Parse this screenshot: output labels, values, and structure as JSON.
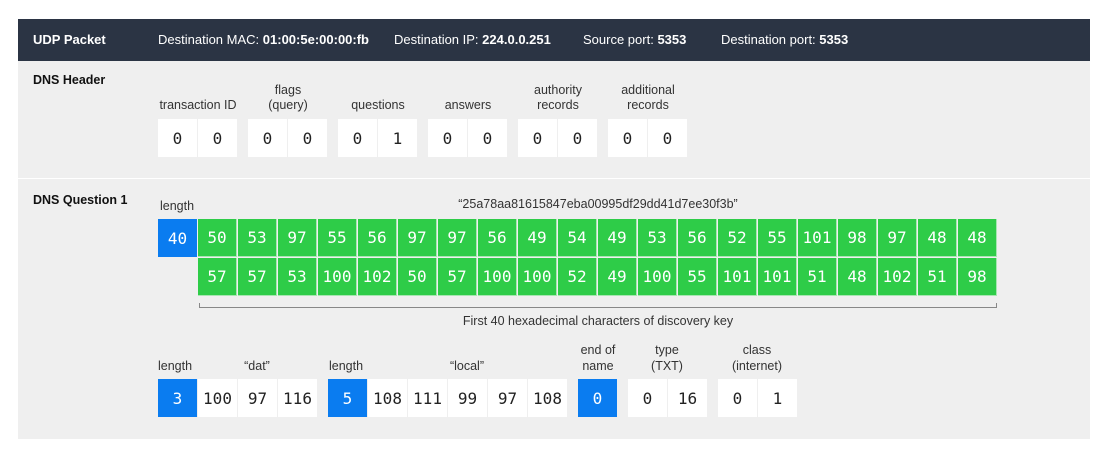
{
  "topbar": {
    "title": "UDP Packet",
    "dest_mac_label": "Destination MAC:",
    "dest_mac_value": "01:00:5e:00:00:fb",
    "dest_ip_label": "Destination IP:",
    "dest_ip_value": "224.0.0.251",
    "src_port_label": "Source port:",
    "src_port_value": "5353",
    "dest_port_label": "Destination port:",
    "dest_port_value": "5353"
  },
  "header": {
    "title": "DNS Header",
    "fields": [
      {
        "label1": "",
        "label2": "transaction ID",
        "values": [
          "0",
          "0"
        ]
      },
      {
        "label1": "flags",
        "label2": "(query)",
        "values": [
          "0",
          "0"
        ]
      },
      {
        "label1": "",
        "label2": "questions",
        "values": [
          "0",
          "1"
        ]
      },
      {
        "label1": "",
        "label2": "answers",
        "values": [
          "0",
          "0"
        ]
      },
      {
        "label1": "authority",
        "label2": "records",
        "values": [
          "0",
          "0"
        ]
      },
      {
        "label1": "additional",
        "label2": "records",
        "values": [
          "0",
          "0"
        ]
      }
    ]
  },
  "question": {
    "title": "DNS Question 1",
    "length_label": "length",
    "length_value": "40",
    "key_string": "“25a78aa81615847eba00995df29dd41d7ee30f3b”",
    "row1": [
      "50",
      "53",
      "97",
      "55",
      "56",
      "97",
      "97",
      "56",
      "49",
      "54",
      "49",
      "53",
      "56",
      "52",
      "55",
      "101",
      "98",
      "97",
      "48",
      "48"
    ],
    "row2": [
      "57",
      "57",
      "53",
      "100",
      "102",
      "50",
      "57",
      "100",
      "100",
      "52",
      "49",
      "100",
      "55",
      "101",
      "101",
      "51",
      "48",
      "102",
      "51",
      "98"
    ],
    "bracket_caption": "First 40 hexadecimal characters of discovery key",
    "dat_length_label": "length",
    "dat_length": "3",
    "dat_label": "“dat”",
    "dat_values": [
      "100",
      "97",
      "116"
    ],
    "local_length_label": "length",
    "local_length": "5",
    "local_label": "“local”",
    "local_values": [
      "108",
      "111",
      "99",
      "97",
      "108"
    ],
    "end_label1": "end of",
    "end_label2": "name",
    "end_value": "0",
    "type_label1": "type",
    "type_label2": "(TXT)",
    "type_values": [
      "0",
      "16"
    ],
    "class_label1": "class",
    "class_label2": "(internet)",
    "class_values": [
      "0",
      "1"
    ]
  },
  "colors": {
    "topbar": "#2b3444",
    "panel": "#efefef",
    "green": "#2ecc48",
    "blue": "#0a7cf0"
  }
}
